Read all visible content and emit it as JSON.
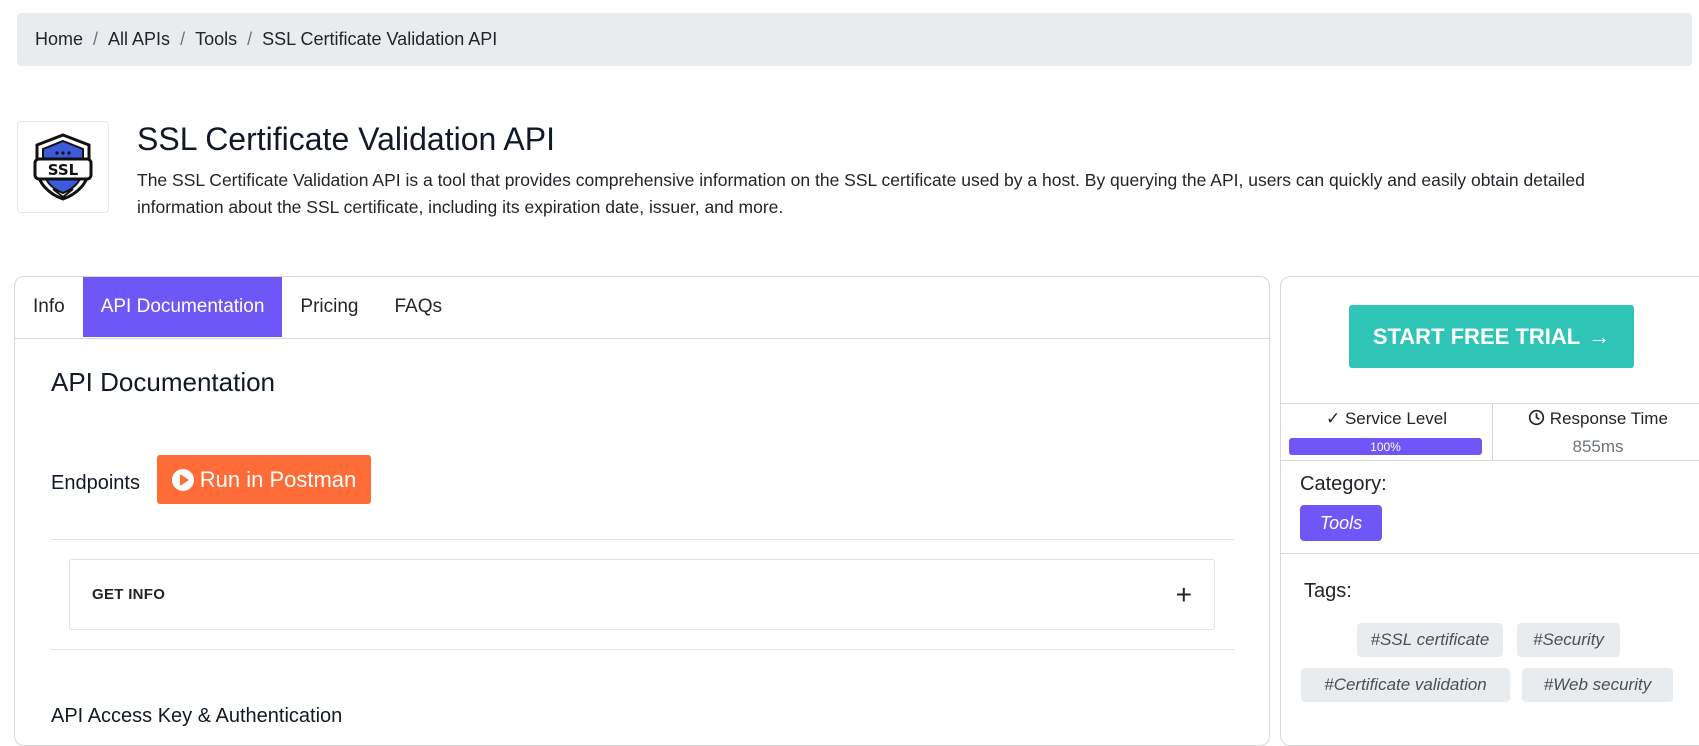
{
  "breadcrumb": {
    "items": [
      "Home",
      "All APIs",
      "Tools",
      "SSL Certificate Validation API"
    ],
    "separator": "/"
  },
  "api": {
    "logo_text": "SSL",
    "title": "SSL Certificate Validation API",
    "description": "The SSL Certificate Validation API is a tool that provides comprehensive information on the SSL certificate used by a host. By querying the API, users can quickly and easily obtain detailed information about the SSL certificate, including its expiration date, issuer, and more."
  },
  "tabs": [
    {
      "label": "Info",
      "active": false
    },
    {
      "label": "API Documentation",
      "active": true
    },
    {
      "label": "Pricing",
      "active": false
    },
    {
      "label": "FAQs",
      "active": false
    }
  ],
  "docs": {
    "heading": "API Documentation",
    "endpoints_label": "Endpoints",
    "postman_button": "Run in Postman",
    "endpoint_item": "GET INFO",
    "auth_heading": "API Access Key & Authentication"
  },
  "sidebar": {
    "trial_button": "START FREE TRIAL",
    "trial_arrow": "→",
    "service_level_label": "Service Level",
    "service_level_value": "100%",
    "service_level_fraction": 1.0,
    "response_time_label": "Response Time",
    "response_time_value": "855ms",
    "category_label": "Category:",
    "category_value": "Tools",
    "tags_label": "Tags:",
    "tags": [
      "#SSL certificate",
      "#Security",
      "#Certificate validation",
      "#Web security"
    ]
  },
  "colors": {
    "accent": "#6f56f7",
    "trial": "#2ec4b6",
    "postman": "#ff6c37",
    "breadcrumb_bg": "#e9ecef"
  }
}
